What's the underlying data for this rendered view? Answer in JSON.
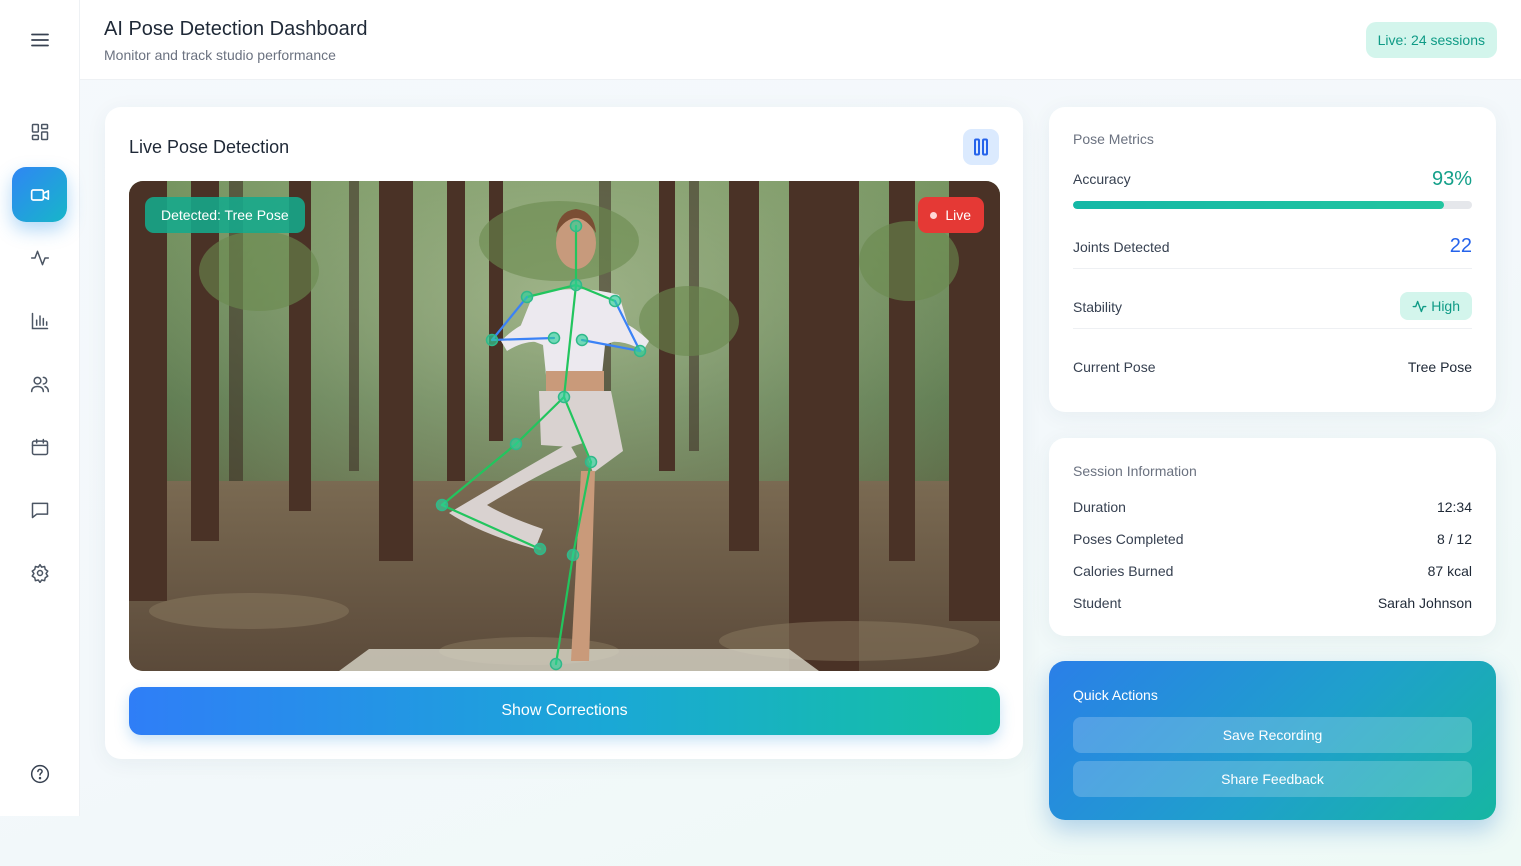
{
  "header": {
    "title": "AI Pose Detection Dashboard",
    "subtitle": "Monitor and track studio performance",
    "live_badge": "Live: 24 sessions"
  },
  "sidebar": {
    "items": [
      {
        "icon": "dashboard-icon",
        "active": false
      },
      {
        "icon": "video-icon",
        "active": true
      },
      {
        "icon": "activity-icon",
        "active": false
      },
      {
        "icon": "bar-chart-icon",
        "active": false
      },
      {
        "icon": "users-icon",
        "active": false
      },
      {
        "icon": "calendar-icon",
        "active": false
      },
      {
        "icon": "message-icon",
        "active": false
      },
      {
        "icon": "settings-icon",
        "active": false
      }
    ],
    "help_icon": "help-icon"
  },
  "video": {
    "title": "Live Pose Detection",
    "detected_label": "Detected: Tree Pose",
    "live_label": "Live",
    "corrections_button": "Show Corrections"
  },
  "metrics": {
    "title": "Pose Metrics",
    "accuracy_label": "Accuracy",
    "accuracy_value": "93%",
    "accuracy_fraction": 0.93,
    "joints_label": "Joints Detected",
    "joints_value": "22",
    "stability_label": "Stability",
    "stability_value": "High",
    "pose_label": "Current Pose",
    "pose_value": "Tree Pose"
  },
  "session": {
    "title": "Session Information",
    "rows": [
      {
        "label": "Duration",
        "value": "12:34"
      },
      {
        "label": "Poses Completed",
        "value": "8 / 12"
      },
      {
        "label": "Calories Burned",
        "value": "87 kcal"
      },
      {
        "label": "Student",
        "value": "Sarah Johnson"
      }
    ]
  },
  "actions": {
    "title": "Quick Actions",
    "save_label": "Save Recording",
    "share_label": "Share Feedback"
  },
  "colors": {
    "accent_teal": "#14a08a",
    "accent_blue": "#2563eb",
    "live_red": "#e53935"
  }
}
